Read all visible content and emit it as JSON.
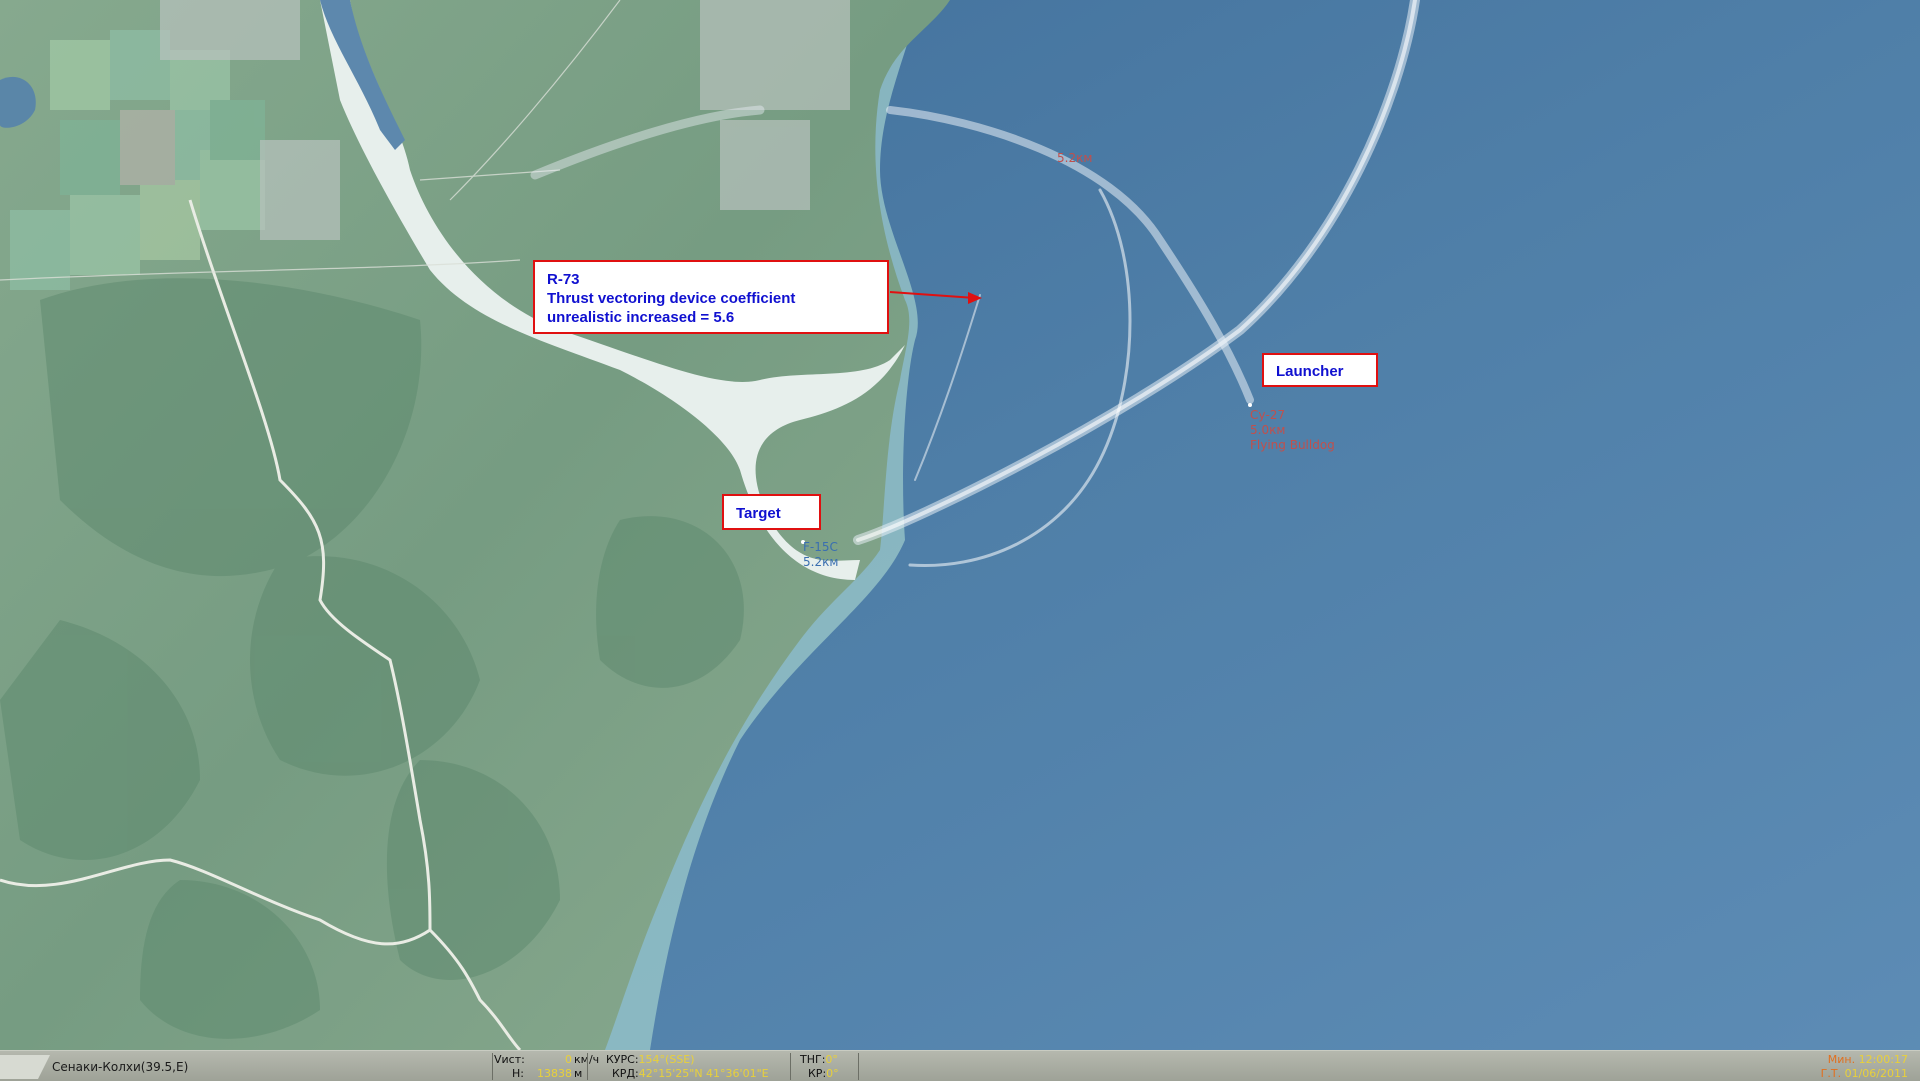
{
  "airfield": "Сенаки-Колхи(39.5,E)",
  "callouts": {
    "missile": {
      "line1": "R-73",
      "line2": "Thrust vectoring device coefficient",
      "line3": "unrealistic increased = 5.6"
    },
    "launcher": "Launcher",
    "target": "Target"
  },
  "units": {
    "launcher": {
      "type": "Су-27",
      "range": "5.0км",
      "callsign": "Flying Bulldog"
    },
    "target": {
      "type": "F-15C",
      "range": "5.2км"
    },
    "trail_range": "5.2км"
  },
  "statusbar": {
    "speed_label": "Vист:",
    "speed_value": "0",
    "speed_unit": "км/ч",
    "alt_label": "H:",
    "alt_value": "13838",
    "alt_unit": "м",
    "course_label": "КУРС:",
    "course_value": "154°(SSE)",
    "coord_label": "КРД:",
    "coord_value": "42°15'25\"N 41°36'01\"E",
    "pitch_label": "ТНГ:",
    "pitch_value": "0°",
    "roll_label": "КР:",
    "roll_value": "0°",
    "time_label": "Мин.",
    "time_value": "12:00:17",
    "date_label": "Г.Т.",
    "date_value": "01/06/2011"
  },
  "colors": {
    "sea": "#4f7fa8",
    "land": "#7fa38b",
    "callout_border": "#e01010",
    "callout_text": "#1010d0",
    "red_label": "#c0504d",
    "blue_label": "#3a6fb0",
    "status_value": "#e8d03a"
  }
}
